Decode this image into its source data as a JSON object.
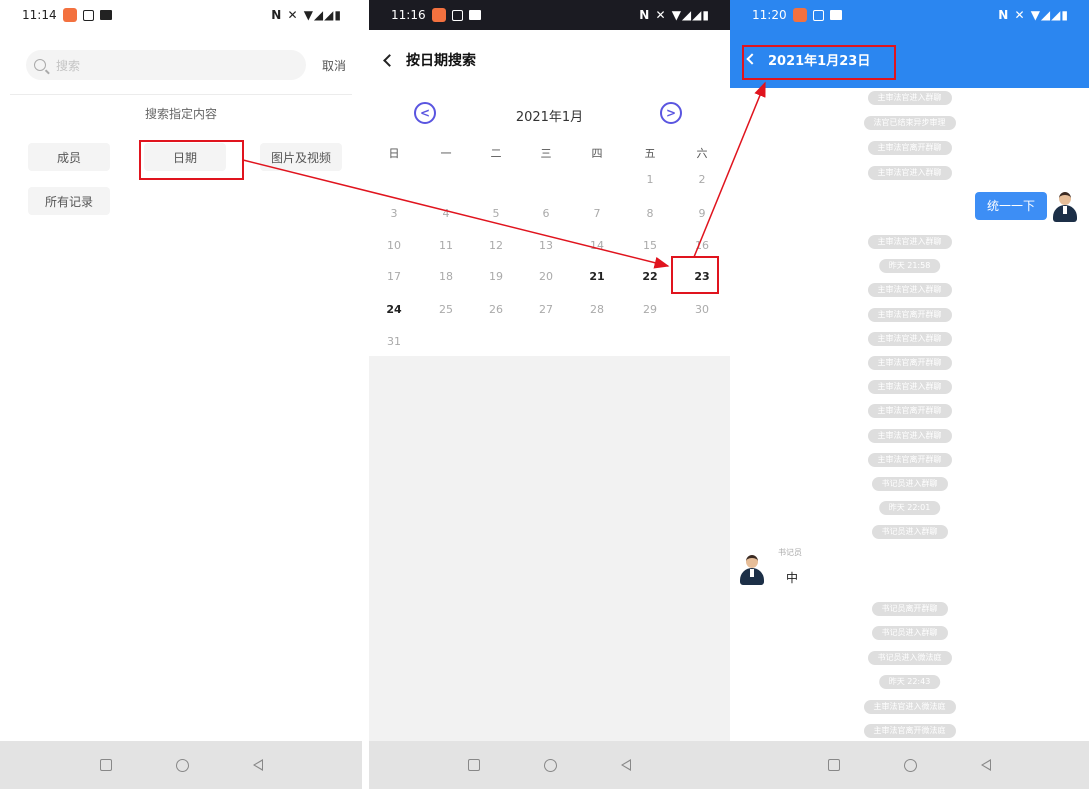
{
  "status_bars": [
    {
      "time": "11:14",
      "signal": "N ✕ ▼◢◢▮"
    },
    {
      "time": "11:16",
      "signal": "N ✕ ▼◢◢▮"
    },
    {
      "time": "11:20",
      "signal": "N ✕ ▼◢◢▮"
    }
  ],
  "search_screen": {
    "search_placeholder": "搜索",
    "cancel_label": "取消",
    "section_title": "搜索指定内容",
    "chips": {
      "members": "成员",
      "date": "日期",
      "media": "图片及视频",
      "all_records": "所有记录"
    }
  },
  "calendar_screen": {
    "title": "按日期搜索",
    "prev_label": "<",
    "next_label": ">",
    "month_label": "2021年1月",
    "weekdays": [
      "日",
      "一",
      "二",
      "三",
      "四",
      "五",
      "六"
    ],
    "weeks": [
      [
        "",
        "",
        "",
        "",
        "",
        "1",
        "2"
      ],
      [
        "3",
        "4",
        "5",
        "6",
        "7",
        "8",
        "9"
      ],
      [
        "10",
        "11",
        "12",
        "13",
        "14",
        "15",
        "16"
      ],
      [
        "17",
        "18",
        "19",
        "20",
        "21",
        "22",
        "23"
      ],
      [
        "24",
        "25",
        "26",
        "27",
        "28",
        "29",
        "30"
      ],
      [
        "31",
        "",
        "",
        "",
        "",
        "",
        ""
      ]
    ],
    "highlighted_days": [
      "21",
      "22",
      "23",
      "24"
    ],
    "selected_day": "23"
  },
  "chat_screen": {
    "title": "2021年1月23日",
    "my_message": "统一一下",
    "sender_name": "书记员",
    "other_message": "中",
    "pills_top": [
      "主审法官进入群聊",
      "法官已结束异步审理",
      "主审法官离开群聊",
      "主审法官进入群聊"
    ],
    "pills_mid": [
      "主审法官进入群聊",
      "昨天 21:58",
      "主审法官进入群聊",
      "主审法官离开群聊",
      "主审法官进入群聊",
      "主审法官离开群聊",
      "主审法官进入群聊",
      "主审法官离开群聊",
      "主审法官进入群聊",
      "主审法官离开群聊",
      "书记员进入群聊",
      "昨天 22:01",
      "书记员进入群聊"
    ],
    "pills_bottom": [
      "书记员离开群聊",
      "书记员进入群聊",
      "书记员进入微法庭",
      "昨天 22:43",
      "主审法官进入微法庭",
      "主审法官离开微法庭"
    ]
  },
  "colors": {
    "accent_blue": "#2b86f0",
    "annotation_red": "#e0141e",
    "nav_purple": "#5a55e0"
  }
}
